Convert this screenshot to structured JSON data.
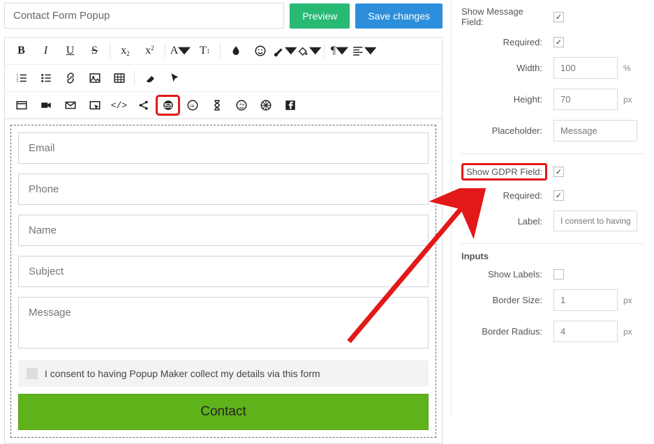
{
  "title": "Contact Form Popup",
  "buttons": {
    "preview": "Preview",
    "save": "Save changes"
  },
  "form": {
    "email_ph": "Email",
    "phone_ph": "Phone",
    "name_ph": "Name",
    "subject_ph": "Subject",
    "message_ph": "Message",
    "consent_label": "I consent to having Popup Maker collect my details via this form",
    "submit_label": "Contact"
  },
  "toolbar": {
    "r1": [
      "bold",
      "italic",
      "underline",
      "strike",
      "sep",
      "sub",
      "sup",
      "sep",
      "font",
      "fontsize",
      "sep",
      "droplet",
      "smiley",
      "brush",
      "bucket",
      "sep",
      "pilcrow",
      "align"
    ],
    "r2": [
      "olist",
      "ulist",
      "link",
      "image",
      "table",
      "sep",
      "eraser",
      "cursor"
    ],
    "r3": [
      "window",
      "video",
      "envelope",
      "pointer",
      "code",
      "share",
      "contact-form",
      "age",
      "hourglass",
      "mail-rocket",
      "cog",
      "facebook"
    ]
  },
  "settings": {
    "show_message_label": "Show Message Field:",
    "required_label": "Required:",
    "width_label": "Width:",
    "width_val": "100",
    "width_unit": "%",
    "height_label": "Height:",
    "height_val": "70",
    "height_unit": "px",
    "placeholder_label": "Placeholder:",
    "placeholder_val": "Message",
    "show_gdpr_label": "Show GDPR Field:",
    "gdpr_required_label": "Required:",
    "gdpr_label_label": "Label:",
    "gdpr_label_val": "I consent to having",
    "inputs_title": "Inputs",
    "show_labels_label": "Show Labels:",
    "border_size_label": "Border Size:",
    "border_size_val": "1",
    "border_size_unit": "px",
    "border_radius_label": "Border Radius:",
    "border_radius_val": "4",
    "border_radius_unit": "px"
  }
}
